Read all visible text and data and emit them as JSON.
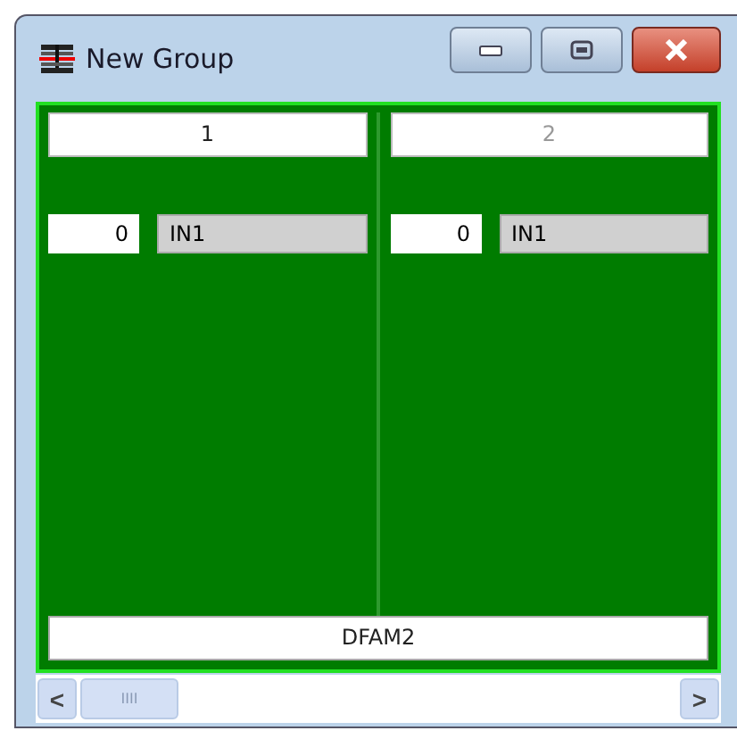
{
  "window": {
    "title": "New Group"
  },
  "channels": [
    {
      "label": "1",
      "enabled": true,
      "value": "0",
      "input": "IN1"
    },
    {
      "label": "2",
      "enabled": false,
      "value": "0",
      "input": "IN1"
    }
  ],
  "footer": "DFAM2",
  "scrollbar": {
    "left": "<",
    "right": ">",
    "grip": "IIII"
  }
}
